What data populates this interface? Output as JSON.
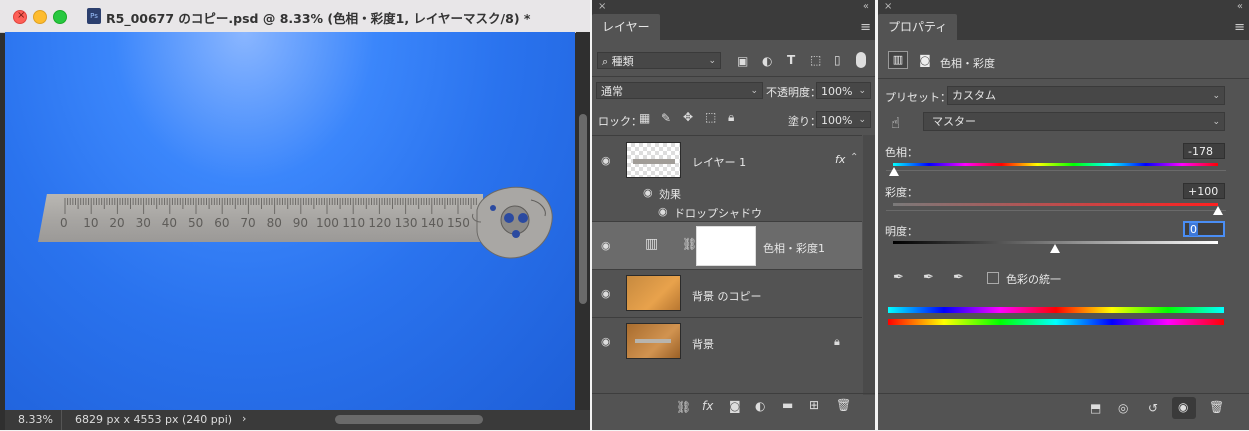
{
  "document": {
    "title": "R5_00677 のコピー.psd @ 8.33% (色相・彩度1, レイヤーマスク/8) *",
    "file_badge": "Ps",
    "zoom": "8.33%",
    "doc_info": "6829 px x 4553 px (240 ppi)",
    "info_arrow": "›",
    "ruler_numbers": [
      "0",
      "10",
      "20",
      "30",
      "40",
      "50",
      "60",
      "70",
      "80",
      "90",
      "100",
      "110",
      "120",
      "130",
      "140",
      "150"
    ]
  },
  "layers_panel": {
    "tab": "レイヤー",
    "filter_label": "種類",
    "blend_mode": "通常",
    "opacity_label": "不透明度：",
    "opacity_value": "100%",
    "lock_label": "ロック：",
    "fill_label": "塗り：",
    "fill_value": "100%",
    "layers": [
      {
        "name": "レイヤー 1",
        "fx": "fx"
      },
      {
        "name": "色相・彩度1"
      },
      {
        "name": "背景 のコピー"
      },
      {
        "name": "背景"
      }
    ],
    "effects_label": "効果",
    "drop_shadow_label": "ドロップシャドウ",
    "footer_fx": "fx"
  },
  "properties_panel": {
    "tab": "プロパティ",
    "header_title": "色相・彩度",
    "preset_label": "プリセット：",
    "preset_value": "カスタム",
    "channel_value": "マスター",
    "hue_label": "色相：",
    "hue_value": "-178",
    "saturation_label": "彩度：",
    "saturation_value": "+100",
    "lightness_label": "明度：",
    "lightness_value": "0",
    "colorize_label": "色彩の統一"
  },
  "colors": {
    "panel_bg": "#535353",
    "canvas_blue": "#2a73ee",
    "tab_header": "#3b3b3b"
  }
}
